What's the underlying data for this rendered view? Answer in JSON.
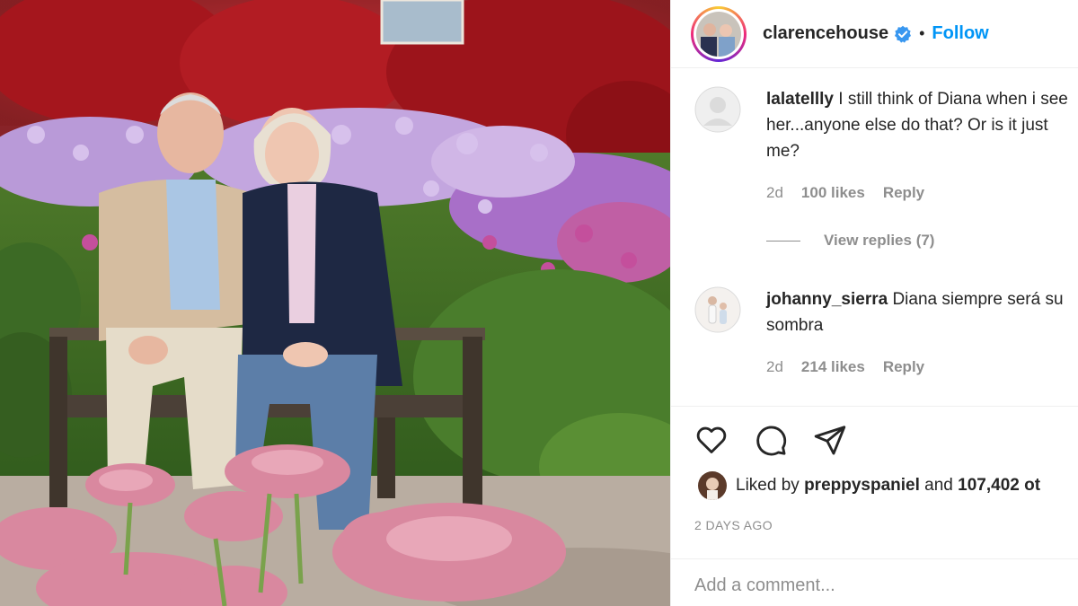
{
  "post": {
    "username": "clarencehouse",
    "verified_icon": "verified-badge-icon",
    "separator": "•",
    "follow_label": "Follow",
    "photo_description_icon": "post-photo"
  },
  "comments": [
    {
      "username": "lalatellly",
      "text": "I still think of Diana when i see her...anyone else do that? Or is it just me?",
      "age": "2d",
      "likes": "100 likes",
      "reply_label": "Reply",
      "view_replies": "View replies (7)"
    },
    {
      "username": "johanny_sierra",
      "text": "Diana siempre será su sombra",
      "age": "2d",
      "likes": "214 likes",
      "reply_label": "Reply"
    }
  ],
  "actions": {
    "like_icon": "heart-icon",
    "comment_icon": "comment-bubble-icon",
    "share_icon": "paper-plane-icon"
  },
  "liked_by": {
    "prefix": "Liked by",
    "user": "preppyspaniel",
    "and": "and",
    "others": "107,402 ot"
  },
  "timestamp": "2 DAYS AGO",
  "add_comment": {
    "placeholder": "Add a comment..."
  },
  "colors": {
    "link_blue": "#0095f6",
    "muted_gray": "#8e8e8e",
    "text": "#262626",
    "verified_blue": "#3897f0"
  }
}
